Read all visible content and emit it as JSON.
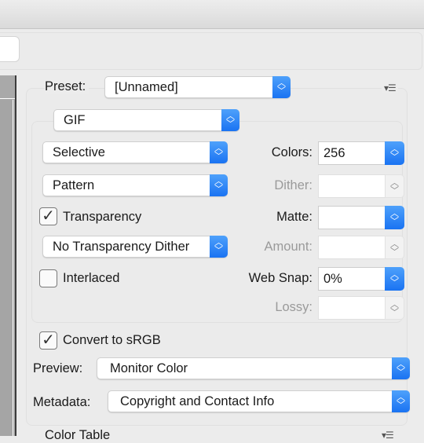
{
  "preset": {
    "label": "Preset:",
    "value": "[Unnamed]"
  },
  "format": {
    "value": "GIF"
  },
  "reduction": {
    "value": "Selective"
  },
  "dither_algorithm": {
    "value": "Pattern"
  },
  "colors": {
    "label": "Colors:",
    "value": "256"
  },
  "dither": {
    "label": "Dither:",
    "value": ""
  },
  "transparency": {
    "label": "Transparency",
    "checked": true
  },
  "matte": {
    "label": "Matte:",
    "value": ""
  },
  "transparency_dither": {
    "value": "No Transparency Dither"
  },
  "amount": {
    "label": "Amount:",
    "value": ""
  },
  "interlaced": {
    "label": "Interlaced",
    "checked": false
  },
  "web_snap": {
    "label": "Web Snap:",
    "value": "0%"
  },
  "lossy": {
    "label": "Lossy:",
    "value": ""
  },
  "convert_srgb": {
    "label": "Convert to sRGB",
    "checked": true
  },
  "preview": {
    "label": "Preview:",
    "value": "Monitor Color"
  },
  "metadata": {
    "label": "Metadata:",
    "value": "Copyright and Contact Info"
  },
  "color_table": {
    "label": "Color Table"
  },
  "icons": {
    "stepper": "up-down-chevron",
    "panel_menu": "triangle-list-menu",
    "check": "checkmark"
  },
  "colors_theme": {
    "accent": "#1a73f2",
    "background": "#ececec"
  }
}
